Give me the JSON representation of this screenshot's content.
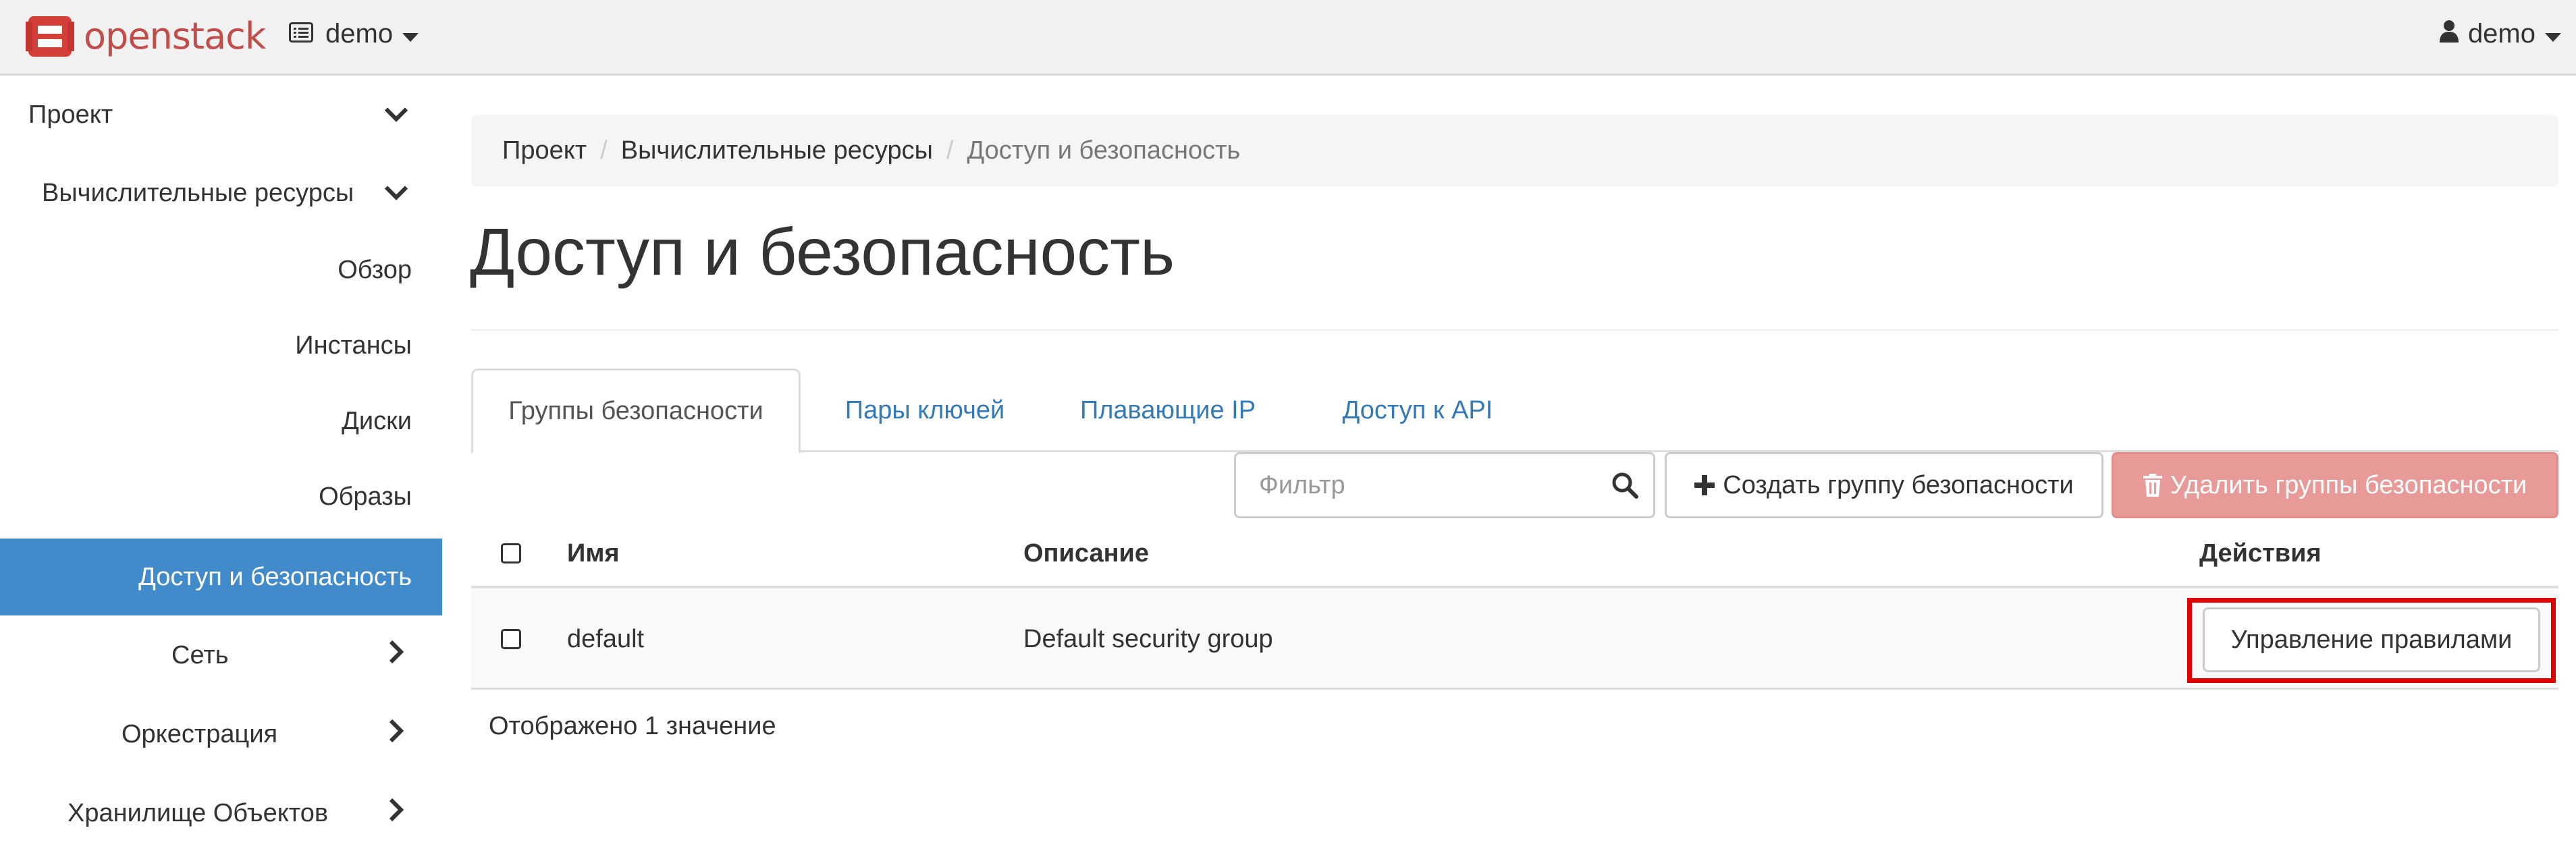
{
  "brand": {
    "logo_text_part1": "open",
    "logo_text_part2": "stack",
    "logo_color": "#d43f3a"
  },
  "topbar": {
    "project_label": "demo",
    "project_icon": "project-list-icon",
    "user_label": "demo",
    "user_icon": "user-icon"
  },
  "sidebar": {
    "items": [
      {
        "label": "Проект",
        "chevron": "chevron-down"
      },
      {
        "label": "Вычислительные ресурсы",
        "chevron": "chevron-down"
      },
      {
        "label": "Обзор"
      },
      {
        "label": "Инстансы"
      },
      {
        "label": "Диски"
      },
      {
        "label": "Образы"
      },
      {
        "label": "Доступ и безопасность",
        "active": true
      },
      {
        "label": "Сеть",
        "chevron": "chevron-right"
      },
      {
        "label": "Оркестрация",
        "chevron": "chevron-right"
      },
      {
        "label": "Хранилище Объектов",
        "chevron": "chevron-right"
      }
    ],
    "active_color": "#428bca"
  },
  "breadcrumb": {
    "items": [
      "Проект",
      "Вычислительные ресурсы",
      "Доступ и безопасность"
    ],
    "separator": "/"
  },
  "page": {
    "title": "Доступ и безопасность"
  },
  "tabs": [
    {
      "label": "Группы безопасности",
      "active": true
    },
    {
      "label": "Пары ключей"
    },
    {
      "label": "Плавающие IP"
    },
    {
      "label": "Доступ к API"
    }
  ],
  "toolbar": {
    "filter_placeholder": "Фильтр",
    "filter_value": "",
    "create_label": "Создать группу безопасности",
    "delete_label": "Удалить группы безопасности",
    "delete_color": "#e89a98"
  },
  "table": {
    "headers": {
      "name": "Имя",
      "description": "Описание",
      "actions": "Действия"
    },
    "rows": [
      {
        "name": "default",
        "description": "Default security group",
        "action_label": "Управление правилами"
      }
    ],
    "footer": "Отображено 1 значение"
  },
  "annotation": {
    "highlight_color": "#e00000"
  }
}
